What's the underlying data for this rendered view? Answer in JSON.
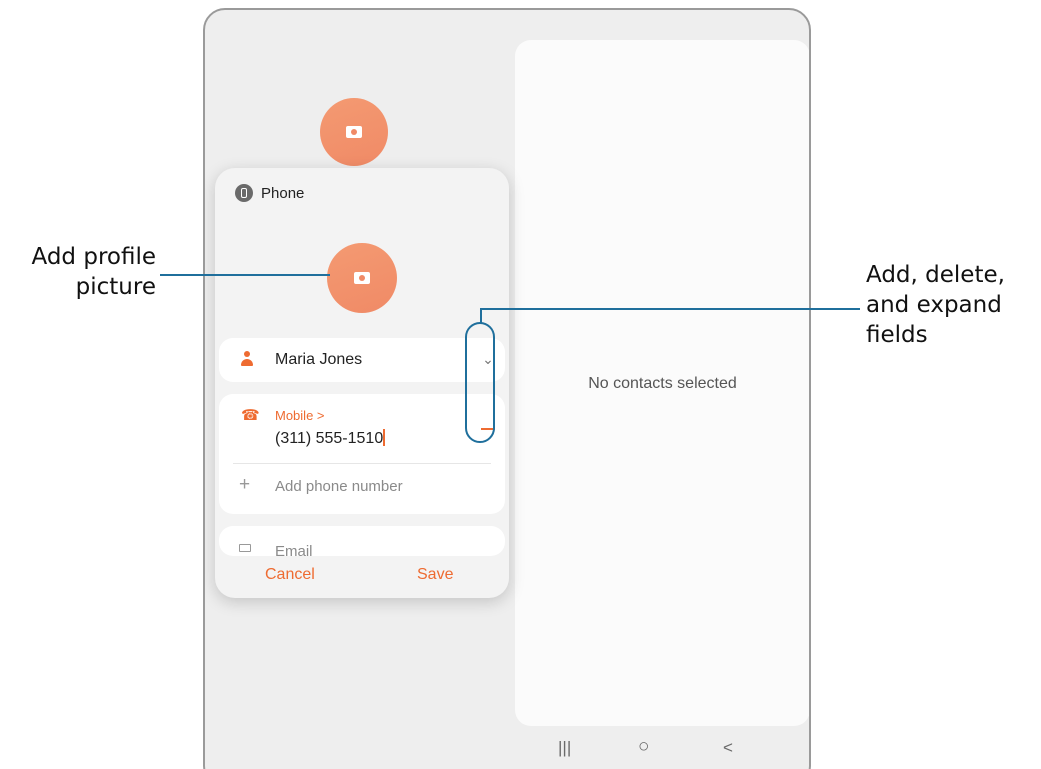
{
  "dialog": {
    "account_label": "Phone",
    "name_value": "Maria Jones",
    "phone_type_label": "Mobile >",
    "phone_number_value": "(311) 555-1510",
    "add_phone_label": "Add phone number",
    "email_label": "Email",
    "cancel_label": "Cancel",
    "save_label": "Save"
  },
  "right_panel": {
    "empty_text": "No contacts selected"
  },
  "nav_bar": {
    "recents": "|||",
    "home": "○",
    "back": "<"
  },
  "annotations": {
    "left": [
      "Add profile",
      "picture"
    ],
    "right": [
      "Add, delete,",
      "and expand",
      "fields"
    ]
  },
  "colors": {
    "accent": "#ee6b31",
    "avatar": "#f08a66",
    "callout_line": "#1f6f9c"
  },
  "icons": [
    "phone-account-icon",
    "camera-icon",
    "person-icon",
    "phone-icon",
    "chevron-down-icon",
    "minus-icon",
    "plus-icon",
    "email-icon"
  ]
}
